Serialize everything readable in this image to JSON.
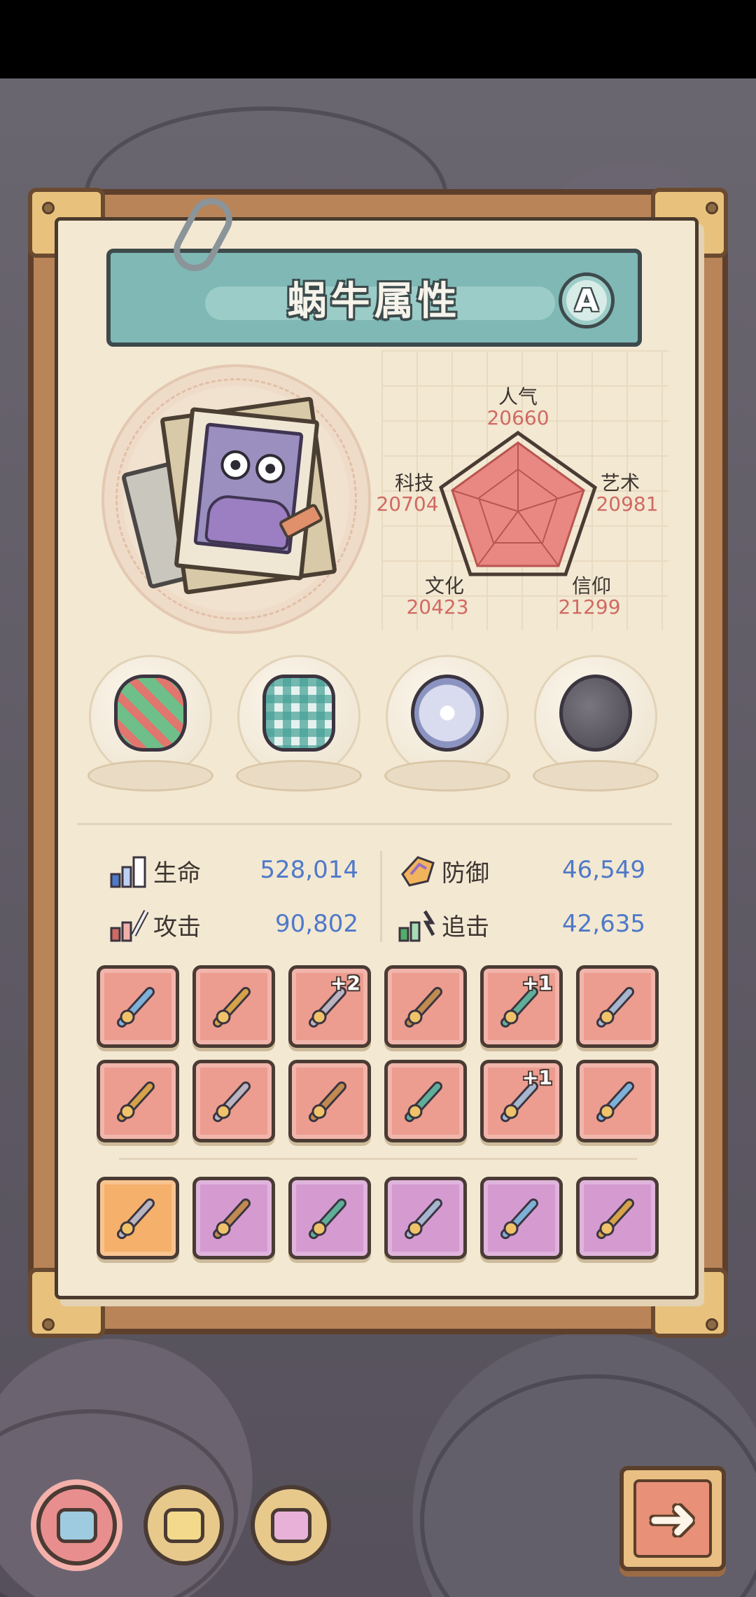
{
  "panel": {
    "title": "蜗牛属性",
    "grade": "A"
  },
  "attributes": {
    "popularity": {
      "label": "人气",
      "value": "20660"
    },
    "art": {
      "label": "艺术",
      "value": "20981"
    },
    "faith": {
      "label": "信仰",
      "value": "21299"
    },
    "culture": {
      "label": "文化",
      "value": "20423"
    },
    "tech": {
      "label": "科技",
      "value": "20704"
    }
  },
  "relics": [
    {
      "icon": "dna-helix-icon"
    },
    {
      "icon": "plaid-shirt-icon"
    },
    {
      "icon": "compass-icon"
    },
    {
      "icon": "meteorite-icon"
    }
  ],
  "stats": {
    "hp": {
      "label": "生命",
      "value": "528,014"
    },
    "defense": {
      "label": "防御",
      "value": "46,549"
    },
    "attack": {
      "label": "攻击",
      "value": "90,802"
    },
    "chase": {
      "label": "追击",
      "value": "42,635"
    }
  },
  "equipment": {
    "row1": [
      {
        "icon": "sword-icon",
        "plus": ""
      },
      {
        "icon": "necklace-icon",
        "plus": ""
      },
      {
        "icon": "dagger-icon",
        "plus": "+2"
      },
      {
        "icon": "crossbow-icon",
        "plus": ""
      },
      {
        "icon": "hammer-icon",
        "plus": "+1"
      },
      {
        "icon": "armor-icon",
        "plus": ""
      }
    ],
    "row2": [
      {
        "icon": "staff-icon",
        "plus": ""
      },
      {
        "icon": "spear-tip-icon",
        "plus": ""
      },
      {
        "icon": "pants-icon",
        "plus": ""
      },
      {
        "icon": "ring-icon",
        "plus": ""
      },
      {
        "icon": "torch-icon",
        "plus": "+1"
      },
      {
        "icon": "helmet-icon",
        "plus": ""
      }
    ],
    "row3": [
      {
        "icon": "saber-icon",
        "plus": ""
      },
      {
        "icon": "gauntlet-icon",
        "plus": ""
      },
      {
        "icon": "chest-icon",
        "plus": ""
      },
      {
        "icon": "scepter-icon",
        "plus": ""
      },
      {
        "icon": "blade-icon",
        "plus": ""
      },
      {
        "icon": "spear-icon",
        "plus": ""
      }
    ]
  },
  "bottom_tabs": [
    {
      "icon": "snail-card-blue-icon"
    },
    {
      "icon": "snail-card-yellow-icon"
    },
    {
      "icon": "snail-card-pink-icon"
    }
  ],
  "next_button": {
    "icon": "right-arrow-icon",
    "glyph": "➜"
  },
  "colors": {
    "radar_fill": "#e98882",
    "stat_value": "#4f79c9",
    "attr_value": "#d06a62",
    "slot_red": "#ec9d8f",
    "slot_purple": "#d59bd0",
    "slot_orange": "#f5b06b"
  }
}
